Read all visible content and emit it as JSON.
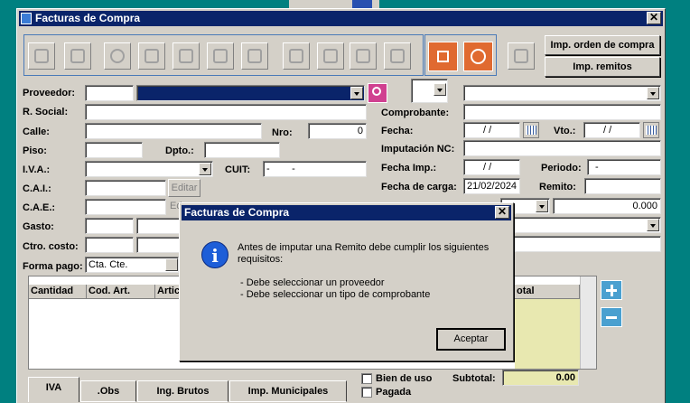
{
  "window": {
    "title": "Facturas de Compra",
    "close": "✕"
  },
  "toolbar": {
    "icons": [
      "add-icon",
      "delete-icon",
      "search-icon",
      "edit-icon",
      "filter-icon",
      "copy-icon",
      "print-icon",
      "first-icon",
      "prev-icon",
      "next-icon",
      "last-icon"
    ],
    "save": "save-icon",
    "cancel": "cancel-icon"
  },
  "side_buttons": {
    "orden": "Imp. orden de compra",
    "remitos": "Imp. remitos"
  },
  "form": {
    "proveedor": "Proveedor:",
    "razon": "R. Social:",
    "calle": "Calle:",
    "nro": "Nro:",
    "nro_value": "0",
    "piso": "Piso:",
    "dpto": "Dpto.:",
    "iva": "I.V.A.:",
    "cuit": "CUIT:",
    "cuit_value": "-        -",
    "cai": "C.A.I.:",
    "cae": "C.A.E.:",
    "editar": "Editar",
    "editar2": "Ed",
    "gasto": "Gasto:",
    "ctro": "Ctro. costo:",
    "forma_pago": "Forma pago:",
    "forma_pago_value": "Cta. Cte.",
    "comprobante": "Comprobante:",
    "fecha": "Fecha:",
    "fecha_value": " / /",
    "vto": "Vto.:",
    "vto_value": " / /",
    "imputacion": "Imputación NC:",
    "fecha_imp": "Fecha Imp.:",
    "fecha_imp_value": " / /",
    "periodo": "Periodo:",
    "periodo_value": "-",
    "fecha_carga": "Fecha de carga:",
    "fecha_carga_value": "21/02/2024",
    "remito": "Remito:",
    "amount": "0.000"
  },
  "grid": {
    "columns": [
      "Cantidad",
      "Cod. Art.",
      "Artic",
      "otal"
    ]
  },
  "tabs": [
    "IVA",
    ".Obs",
    "Ing. Brutos",
    "Imp. Municipales"
  ],
  "footer": {
    "bien_uso": "Bien de uso",
    "pagada": "Pagada",
    "subtotal": "Subtotal:",
    "subtotal_value": "0.00"
  },
  "dialog": {
    "title": "Facturas de Compra",
    "close": "✕",
    "line1": "Antes de imputar una Remito debe cumplir los siguientes",
    "line2": "requisitos:",
    "req1": "- Debe seleccionar un proveedor",
    "req2": "- Debe seleccionar un tipo de comprobante",
    "ok": "Aceptar",
    "icon": "info-icon"
  },
  "colors": {
    "titlebar": "#0a246a",
    "face": "#d4d0c8",
    "desktop": "#008080",
    "accent": "#e06a30",
    "grid_total": "#e8e8b0"
  }
}
